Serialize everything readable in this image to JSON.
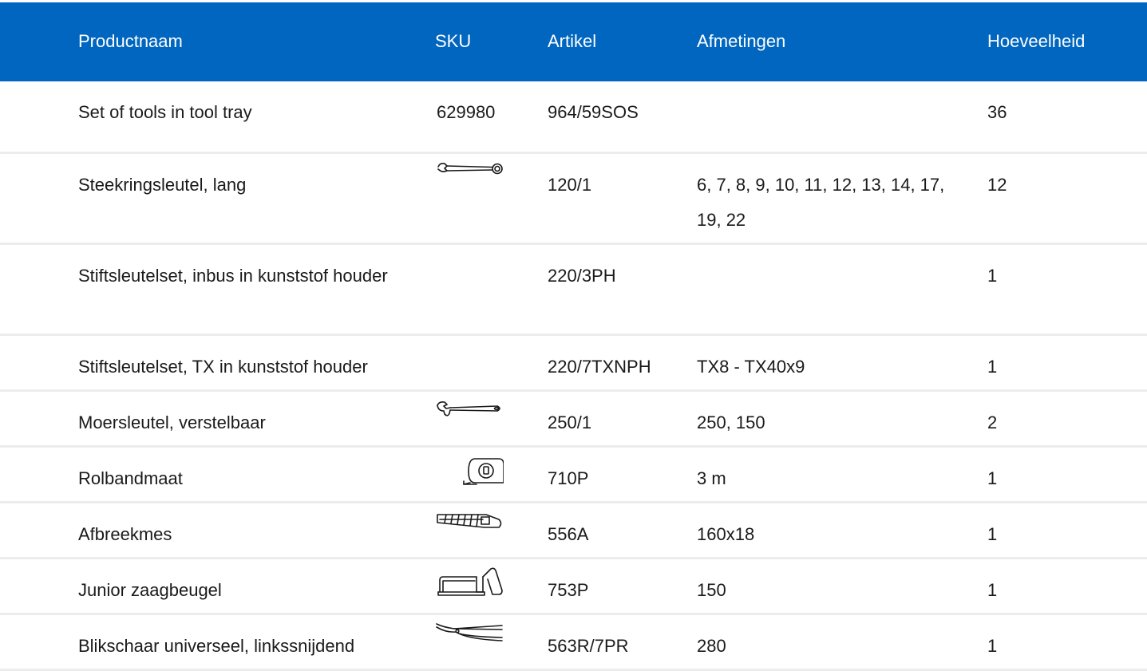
{
  "table": {
    "headers": {
      "name": "Productnaam",
      "sku": "SKU",
      "article": "Artikel",
      "dimensions": "Afmetingen",
      "quantity": "Hoeveelheid"
    },
    "rows": [
      {
        "name": "Set of tools in tool tray",
        "sku": "629980",
        "icon": "",
        "article": "964/59SOS",
        "dimensions": "",
        "quantity": "36"
      },
      {
        "name": "Steekringsleutel, lang",
        "sku": "",
        "icon": "combination-wrench-icon",
        "article": "120/1",
        "dimensions": "6, 7, 8, 9, 10, 11, 12, 13, 14, 17, 19, 22",
        "quantity": "12"
      },
      {
        "name": "Stiftsleutelset, inbus in kunststof houder",
        "sku": "",
        "icon": "",
        "article": "220/3PH",
        "dimensions": "",
        "quantity": "1"
      },
      {
        "name": "Stiftsleutelset, TX in kunststof houder",
        "sku": "",
        "icon": "",
        "article": "220/7TXNPH",
        "dimensions": "TX8 - TX40x9",
        "quantity": "1"
      },
      {
        "name": "Moersleutel, verstelbaar",
        "sku": "",
        "icon": "adjustable-wrench-icon",
        "article": "250/1",
        "dimensions": "250, 150",
        "quantity": "2"
      },
      {
        "name": "Rolbandmaat",
        "sku": "",
        "icon": "tape-measure-icon",
        "article": "710P",
        "dimensions": "3 m",
        "quantity": "1"
      },
      {
        "name": "Afbreekmes",
        "sku": "",
        "icon": "utility-knife-icon",
        "article": "556A",
        "dimensions": "160x18",
        "quantity": "1"
      },
      {
        "name": "Junior zaagbeugel",
        "sku": "",
        "icon": "hacksaw-icon",
        "article": "753P",
        "dimensions": "150",
        "quantity": "1"
      },
      {
        "name": "Blikschaar universeel, linkssnijdend",
        "sku": "",
        "icon": "tin-snips-icon",
        "article": "563R/7PR",
        "dimensions": "280",
        "quantity": "1"
      }
    ]
  },
  "colors": {
    "header_background": "#0066bf",
    "header_text": "#ffffff",
    "row_divider": "#ececec",
    "body_text": "#1a1a1a"
  }
}
